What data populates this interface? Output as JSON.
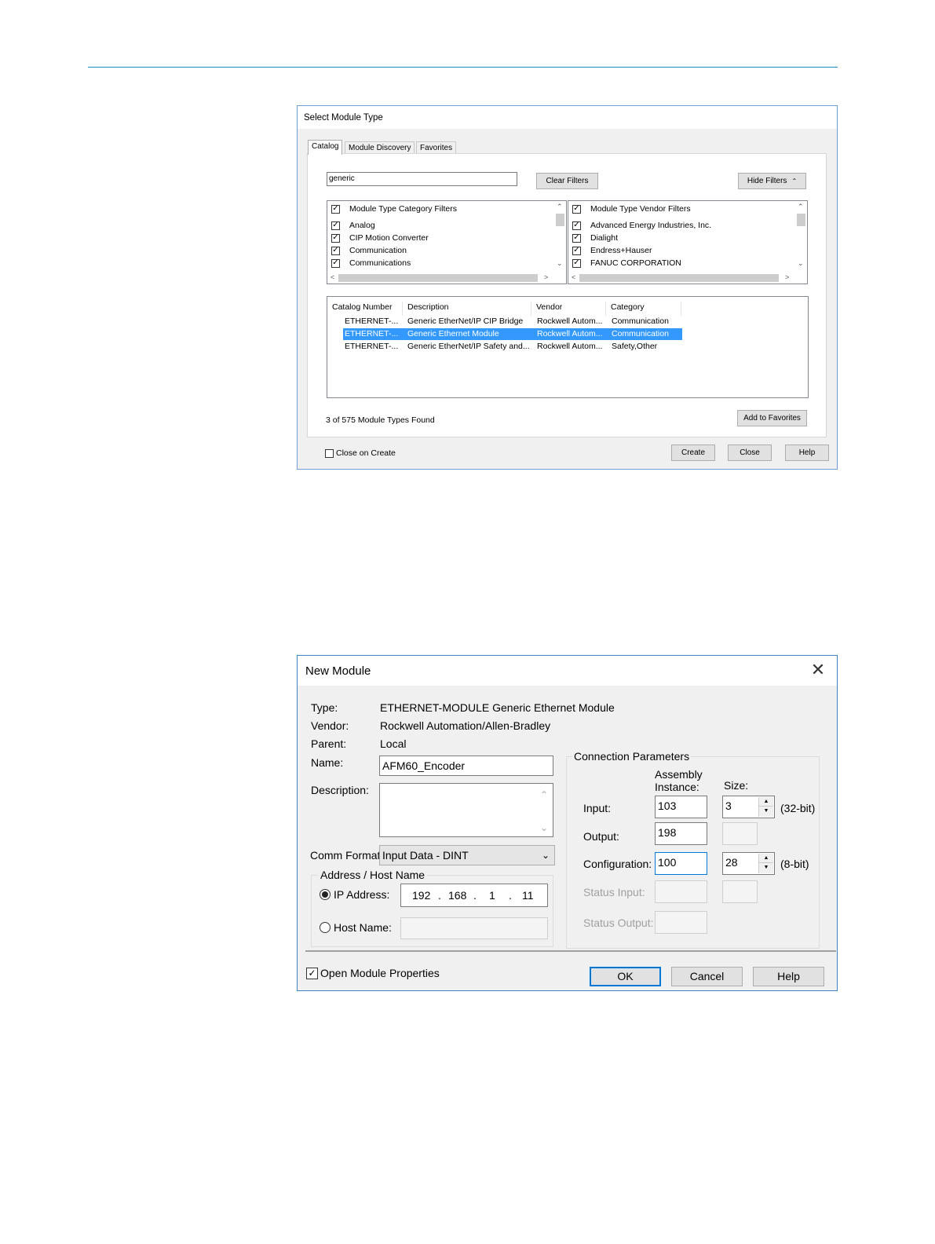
{
  "select_module_type": {
    "title": "Select Module Type",
    "tabs": [
      "Catalog",
      "Module Discovery",
      "Favorites"
    ],
    "search_value": "generic",
    "clear_filters": "Clear Filters",
    "hide_filters": "Hide Filters",
    "category_filters": {
      "header": "Module Type Category Filters",
      "items": [
        "Analog",
        "CIP Motion Converter",
        "Communication",
        "Communications"
      ]
    },
    "vendor_filters": {
      "header": "Module Type Vendor Filters",
      "items": [
        "Advanced Energy Industries, Inc.",
        "Dialight",
        "Endress+Hauser",
        "FANUC CORPORATION"
      ]
    },
    "columns": [
      "Catalog Number",
      "Description",
      "Vendor",
      "Category"
    ],
    "rows": [
      [
        "ETHERNET-...",
        "Generic EtherNet/IP CIP Bridge",
        "Rockwell Autom...",
        "Communication"
      ],
      [
        "ETHERNET-...",
        "Generic Ethernet Module",
        "Rockwell Autom...",
        "Communication"
      ],
      [
        "ETHERNET-...",
        "Generic EtherNet/IP Safety and...",
        "Rockwell Autom...",
        "Safety,Other"
      ]
    ],
    "selected_row": 1,
    "found_text": "3 of 575 Module Types Found",
    "add_to_favorites": "Add to Favorites",
    "close_on_create": "Close on Create",
    "create": "Create",
    "close": "Close",
    "help": "Help"
  },
  "new_module": {
    "title": "New Module",
    "type_label": "Type:",
    "type_value": "ETHERNET-MODULE Generic Ethernet Module",
    "vendor_label": "Vendor:",
    "vendor_value": "Rockwell Automation/Allen-Bradley",
    "parent_label": "Parent:",
    "parent_value": "Local",
    "name_label": "Name:",
    "name_value": "AFM60_Encoder",
    "description_label": "Description:",
    "comm_format_label": "Comm Format:",
    "comm_format_value": "Input Data - DINT",
    "address_group": "Address / Host Name",
    "ip_label": "IP Address:",
    "ip": [
      "192",
      "168",
      "1",
      "11"
    ],
    "host_label": "Host Name:",
    "conn_group": "Connection Parameters",
    "assembly_instance": "Assembly\nInstance:",
    "size_label": "Size:",
    "input_label": "Input:",
    "input_instance": "103",
    "input_size": "3",
    "input_unit": "(32-bit)",
    "output_label": "Output:",
    "output_instance": "198",
    "config_label": "Configuration:",
    "config_instance": "100",
    "config_size": "28",
    "config_unit": "(8-bit)",
    "status_input_label": "Status Input:",
    "status_output_label": "Status Output:",
    "open_module_properties": "Open Module Properties",
    "ok": "OK",
    "cancel": "Cancel",
    "help": "Help"
  }
}
